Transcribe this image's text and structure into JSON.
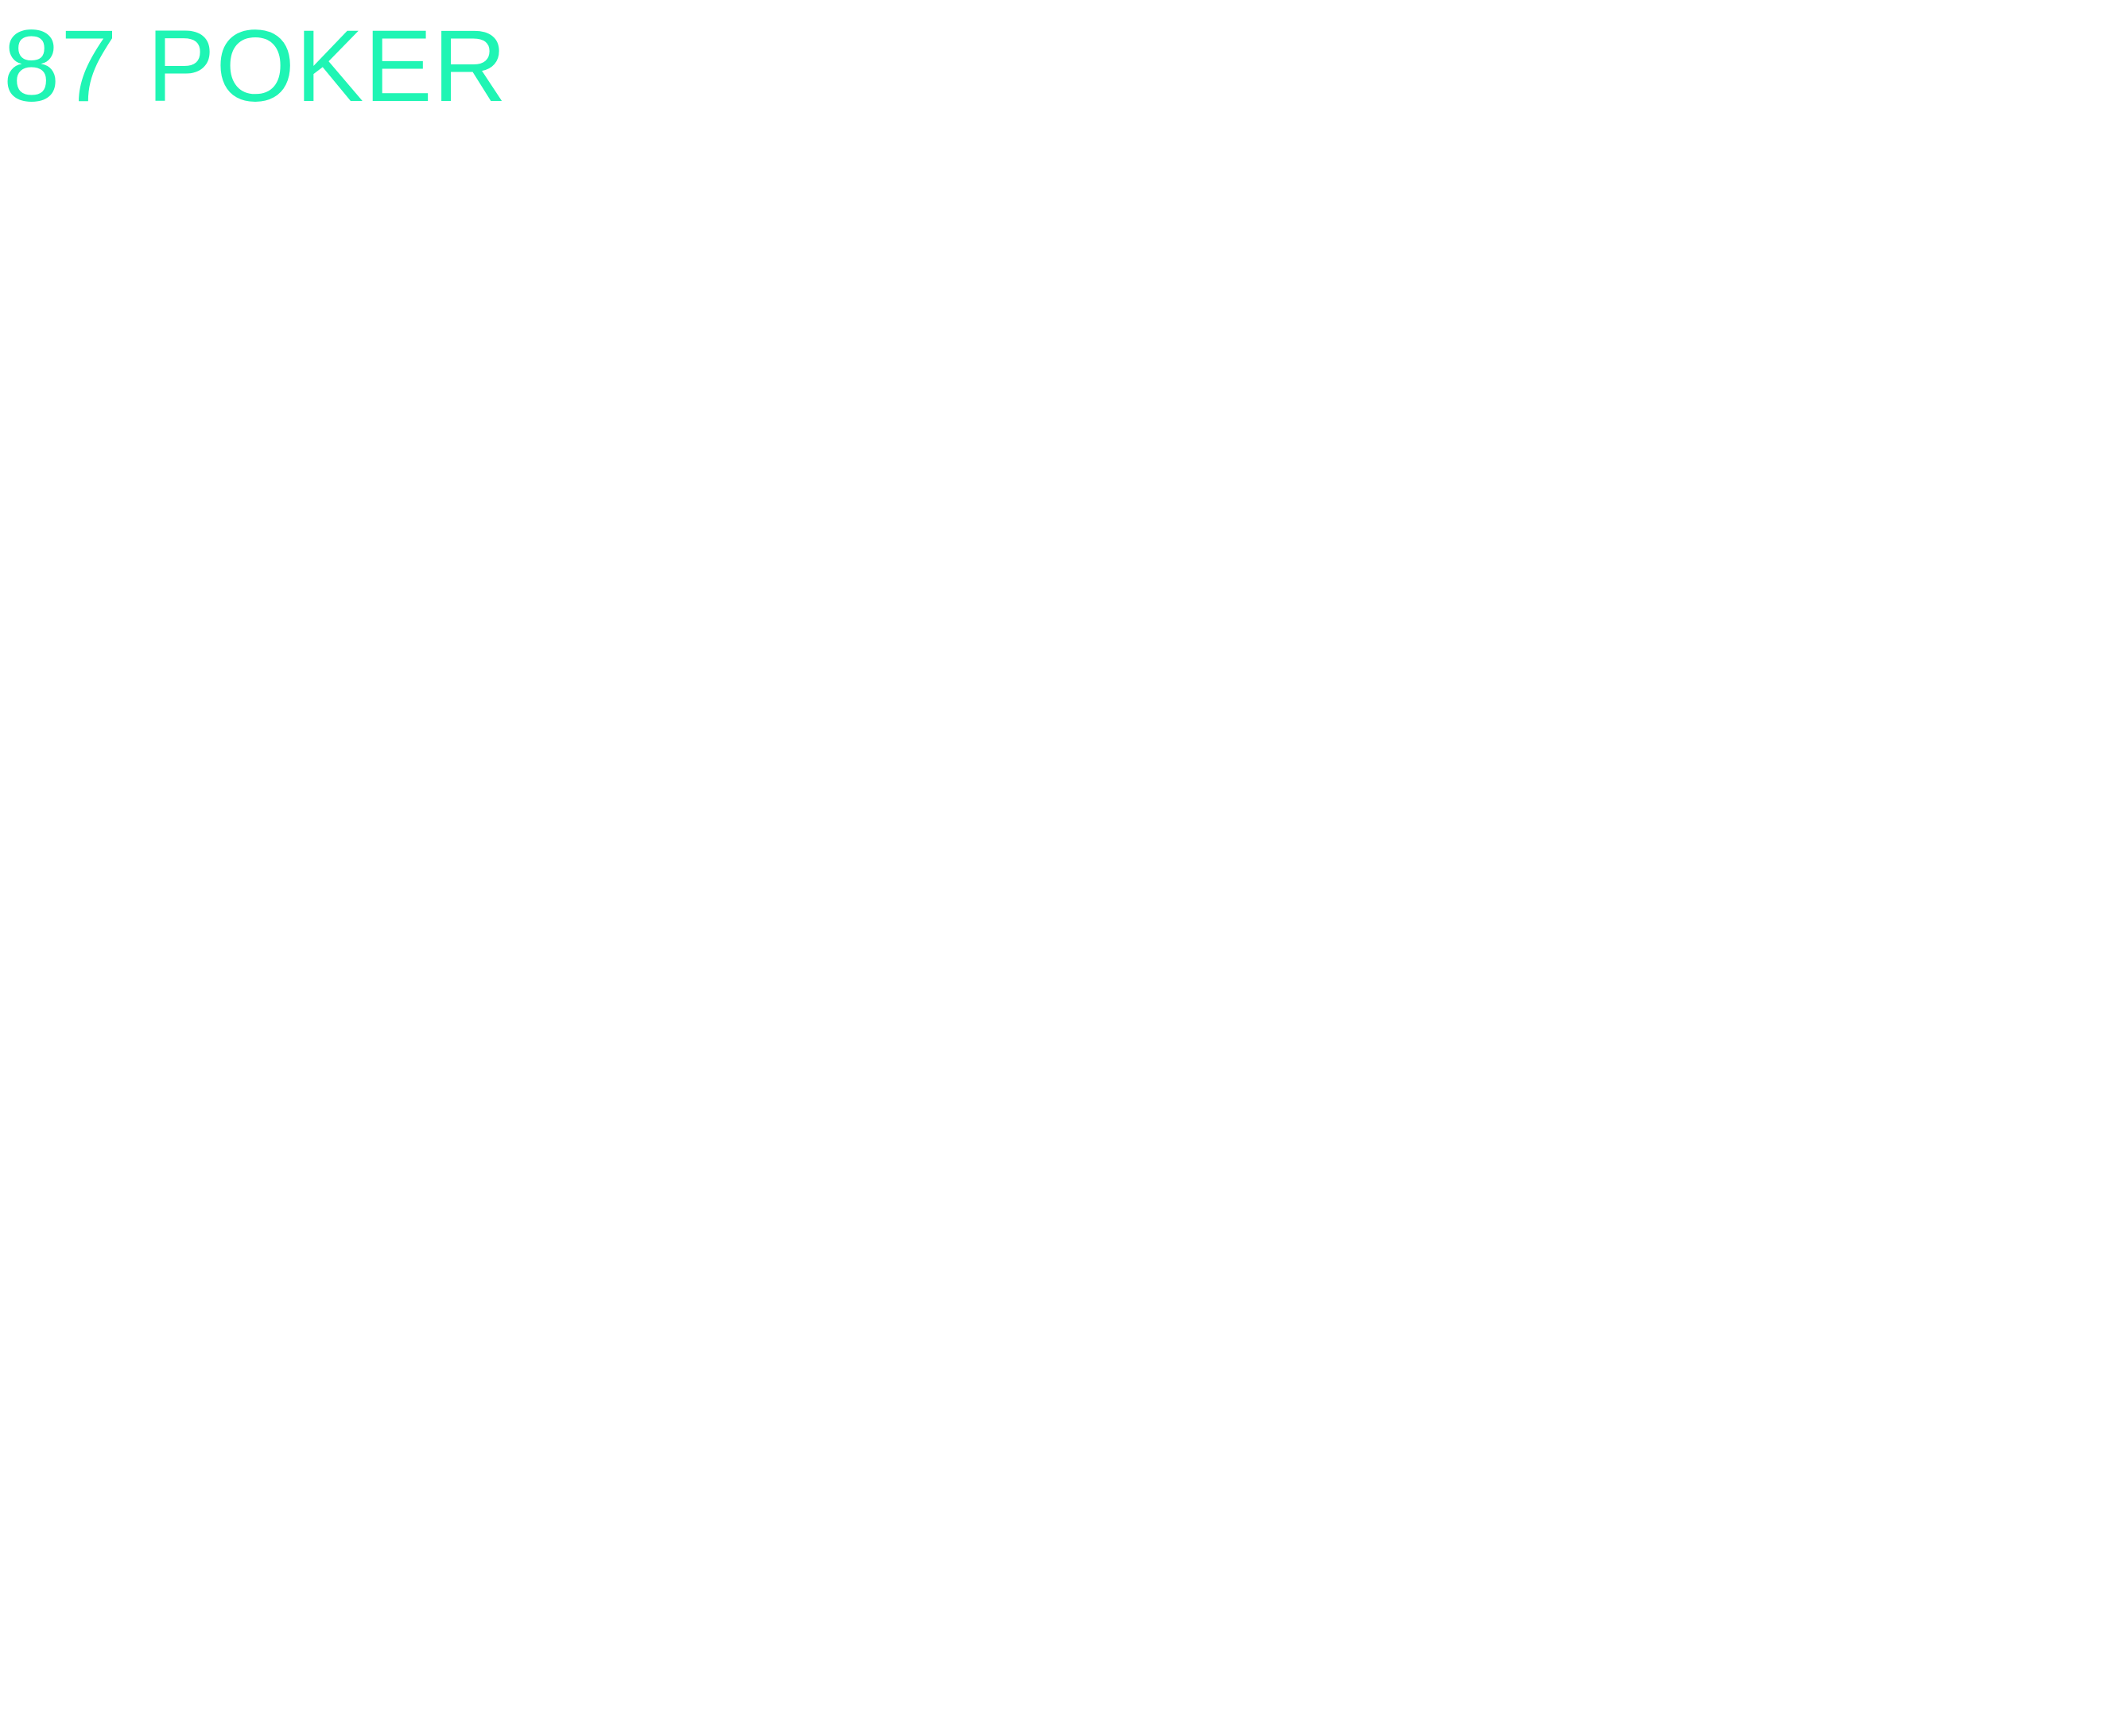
{
  "app": {
    "title": "87 POKER",
    "accent_color": "#1ff5b4"
  }
}
